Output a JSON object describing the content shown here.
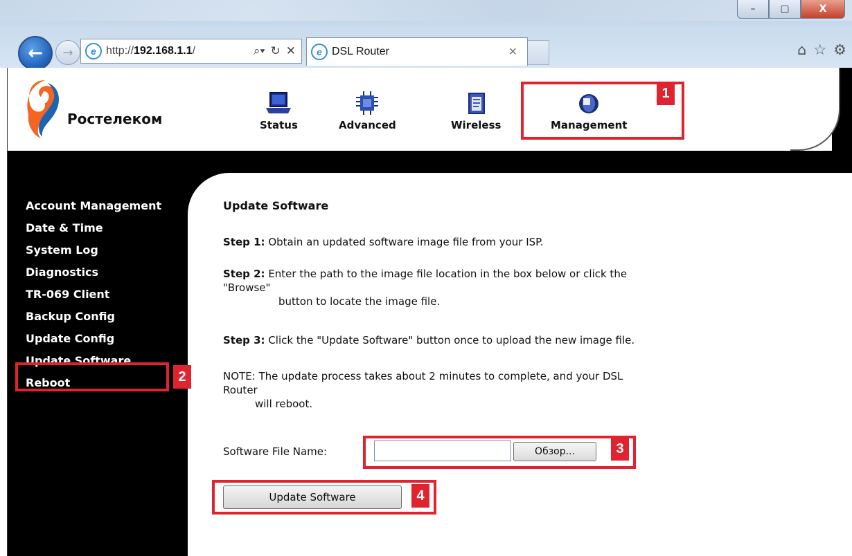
{
  "browser": {
    "url_prefix": "http://",
    "url_host": "192.168.1.1",
    "url_suffix": "/",
    "tab_title": "DSL Router",
    "window_buttons": [
      "–",
      "▢",
      "X"
    ]
  },
  "header": {
    "logo_text": "Ростелеком",
    "nav": [
      {
        "label": "Status",
        "icon": "laptop-icon"
      },
      {
        "label": "Advanced",
        "icon": "chip-icon"
      },
      {
        "label": "Wireless",
        "icon": "clipboard-icon"
      },
      {
        "label": "Management",
        "icon": "management-icon"
      }
    ]
  },
  "sidebar": {
    "items": [
      "Account Management",
      "Date & Time",
      "System Log",
      "Diagnostics",
      "TR-069 Client",
      "Backup Config",
      "Update Config",
      "Update Software",
      "Reboot"
    ],
    "active": "Update Software"
  },
  "main": {
    "title": "Update Software",
    "step1_label": "Step 1:",
    "step1_text": " Obtain an updated software image file from your ISP.",
    "step2_label": "Step 2:",
    "step2_text": " Enter the path to the image file location in the box below or click the",
    "step2_line2": "\"Browse\"",
    "step2_line3": "button to locate the image file.",
    "step3_label": "Step 3:",
    "step3_text": " Click the \"Update Software\" button once to upload the new image file.",
    "note_line1": "NOTE: The update process takes about 2 minutes to complete, and your DSL",
    "note_line2": "Router",
    "note_line3": "will reboot.",
    "file_label": "Software File Name:",
    "file_value": "",
    "browse_label": "Обзор...",
    "update_button": "Update Software"
  },
  "callouts": [
    "1",
    "2",
    "3",
    "4"
  ],
  "colors": {
    "callout": "#e0232e",
    "sidebar_bg": "#000000"
  }
}
